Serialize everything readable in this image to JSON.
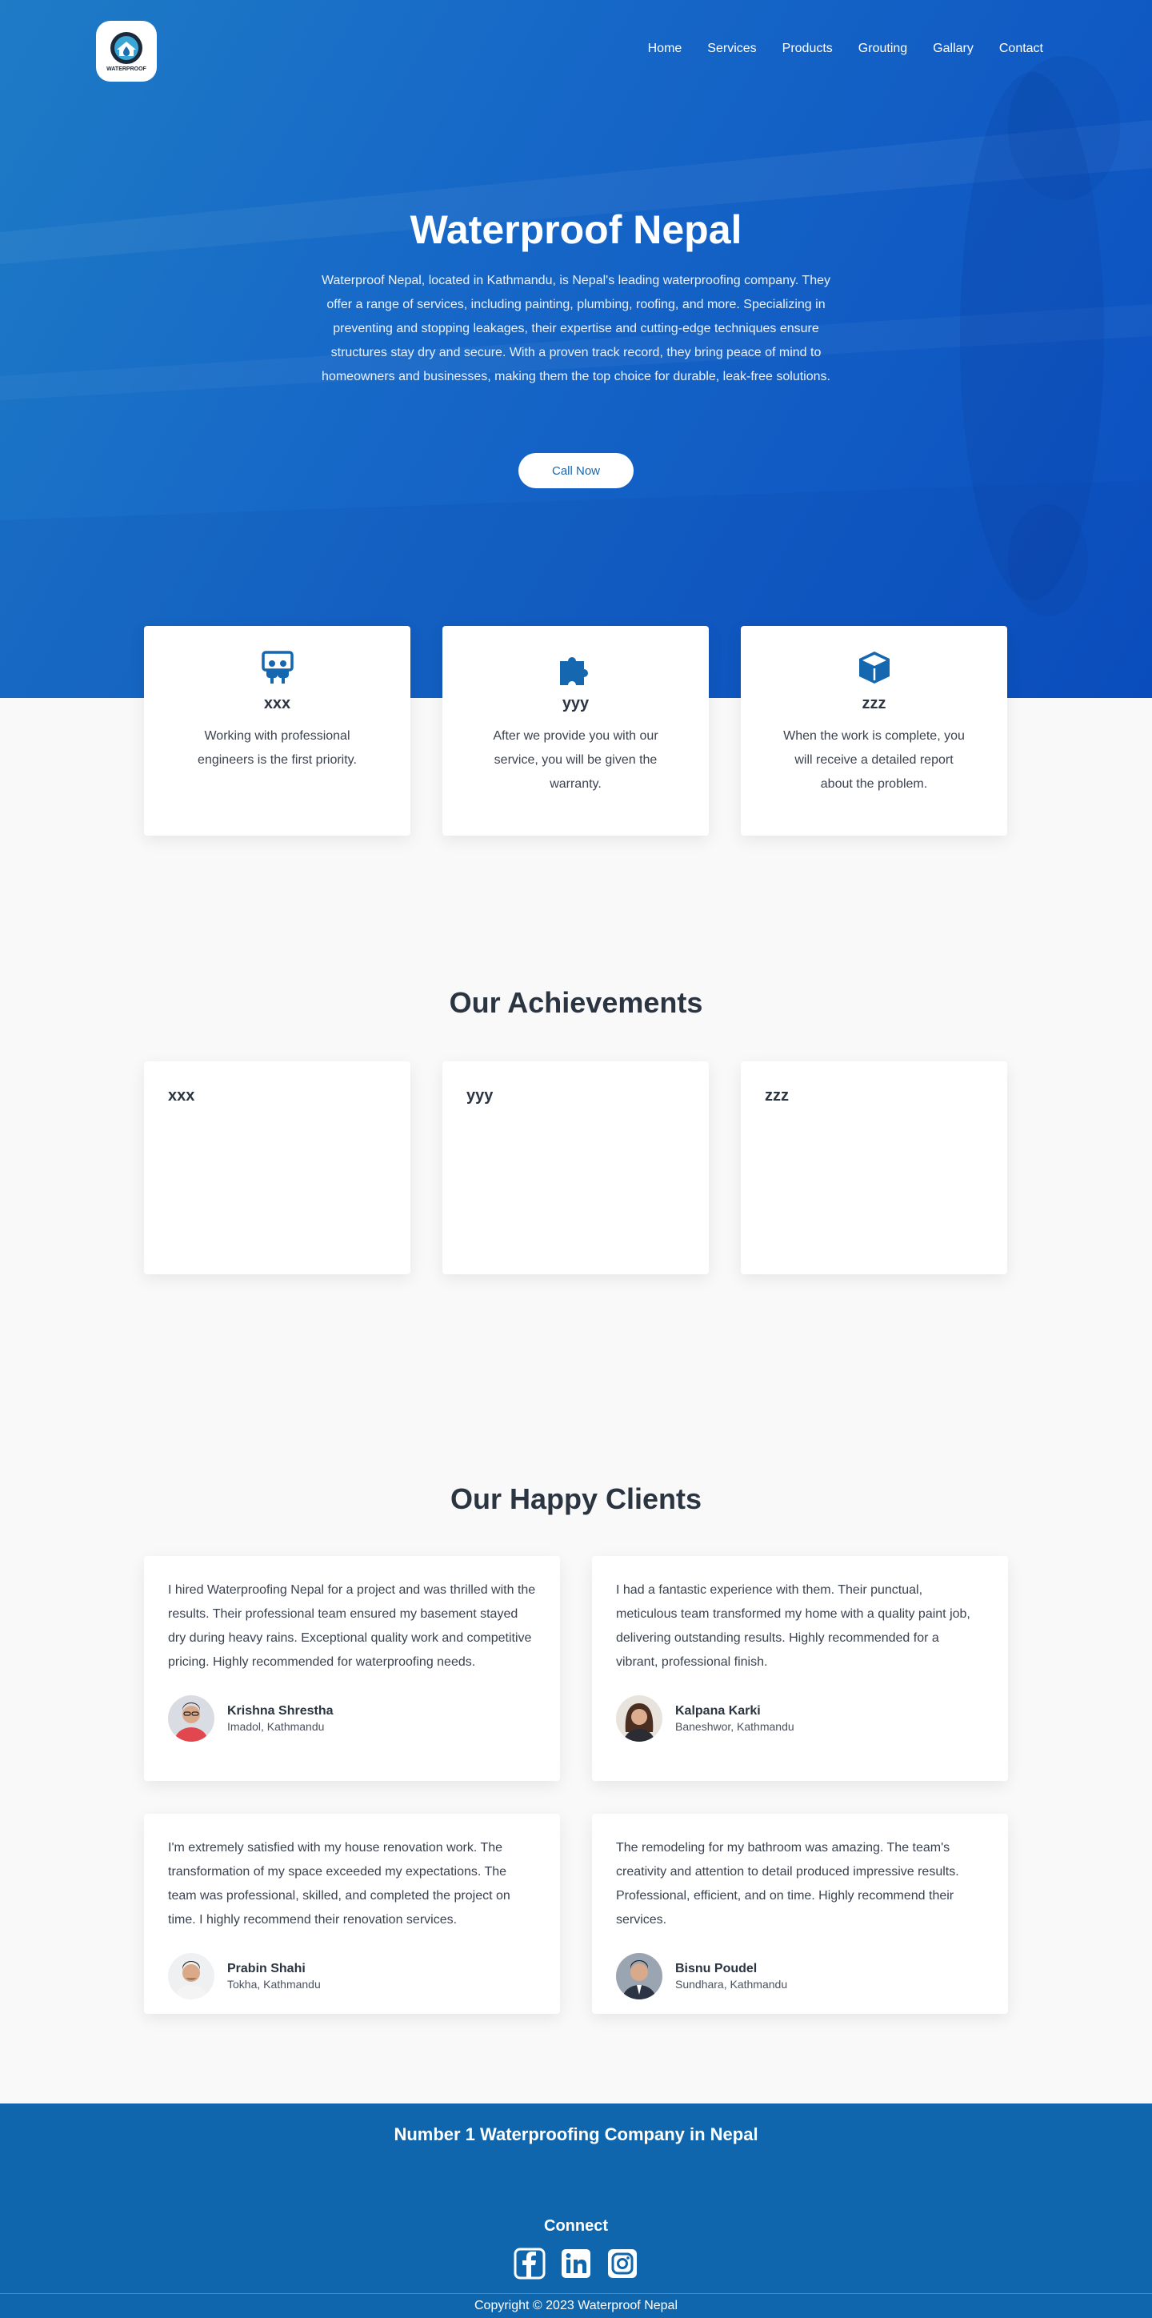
{
  "brand": {
    "logo_text": "WATERPROOF"
  },
  "nav": {
    "items": [
      {
        "label": "Home"
      },
      {
        "label": "Services"
      },
      {
        "label": "Products"
      },
      {
        "label": "Grouting"
      },
      {
        "label": "Gallary"
      },
      {
        "label": "Contact"
      }
    ]
  },
  "hero": {
    "title": "Waterproof Nepal",
    "description": "Waterproof Nepal, located in Kathmandu, is Nepal's leading waterproofing company. They offer a range of services, including painting, plumbing, roofing, and more. Specializing in preventing and stopping leakages, their expertise and cutting-edge techniques ensure structures stay dry and secure. With a proven track record, they bring peace of mind to homeowners and businesses, making them the top choice for durable, leak-free solutions.",
    "cta_label": "Call Now"
  },
  "features": [
    {
      "icon": "users-icon",
      "title": "xxx",
      "text": "Working with professional engineers is the first priority."
    },
    {
      "icon": "puzzle-icon",
      "title": "yyy",
      "text": "After we provide you with our service, you will be given the warranty."
    },
    {
      "icon": "box-icon",
      "title": "zzz",
      "text": "When the work is complete, you will receive a detailed report about the problem."
    }
  ],
  "achievements": {
    "title": "Our Achievements",
    "items": [
      {
        "label": "xxx"
      },
      {
        "label": "yyy"
      },
      {
        "label": "zzz"
      }
    ]
  },
  "clients": {
    "title": "Our Happy Clients",
    "testimonials": [
      {
        "text": "I hired Waterproofing Nepal for a project and was thrilled with the results. Their professional team ensured my basement stayed dry during heavy rains. Exceptional quality work and competitive pricing. Highly recommended for waterproofing needs.",
        "name": "Krishna Shrestha",
        "location": "Imadol, Kathmandu"
      },
      {
        "text": "I had a fantastic experience with them. Their punctual, meticulous team transformed my home with a quality paint job, delivering outstanding results. Highly recommended for a vibrant, professional finish.",
        "name": "Kalpana Karki",
        "location": "Baneshwor, Kathmandu"
      },
      {
        "text": "I'm extremely satisfied with my house renovation work. The transformation of my space exceeded my expectations. The team was professional, skilled, and completed the project on time. I highly recommend their renovation services.",
        "name": "Prabin Shahi",
        "location": "Tokha, Kathmandu"
      },
      {
        "text": "The remodeling for my bathroom was amazing. The team's creativity and attention to detail produced impressive results. Professional, efficient, and on time. Highly recommend their services.",
        "name": "Bisnu Poudel",
        "location": "Sundhara, Kathmandu"
      }
    ]
  },
  "footer": {
    "tagline": "Number 1 Waterproofing Company in Nepal",
    "connect_label": "Connect",
    "socials": [
      {
        "icon": "facebook-icon"
      },
      {
        "icon": "linkedin-icon"
      },
      {
        "icon": "instagram-icon"
      }
    ],
    "copyright": "Copyright © 2023 Waterproof Nepal"
  },
  "colors": {
    "primary": "#1066ad",
    "hero_start": "#1e7bc6",
    "hero_end": "#0b4fc0",
    "text_dark": "#2b3441",
    "page_bg": "#f9f9f9"
  }
}
